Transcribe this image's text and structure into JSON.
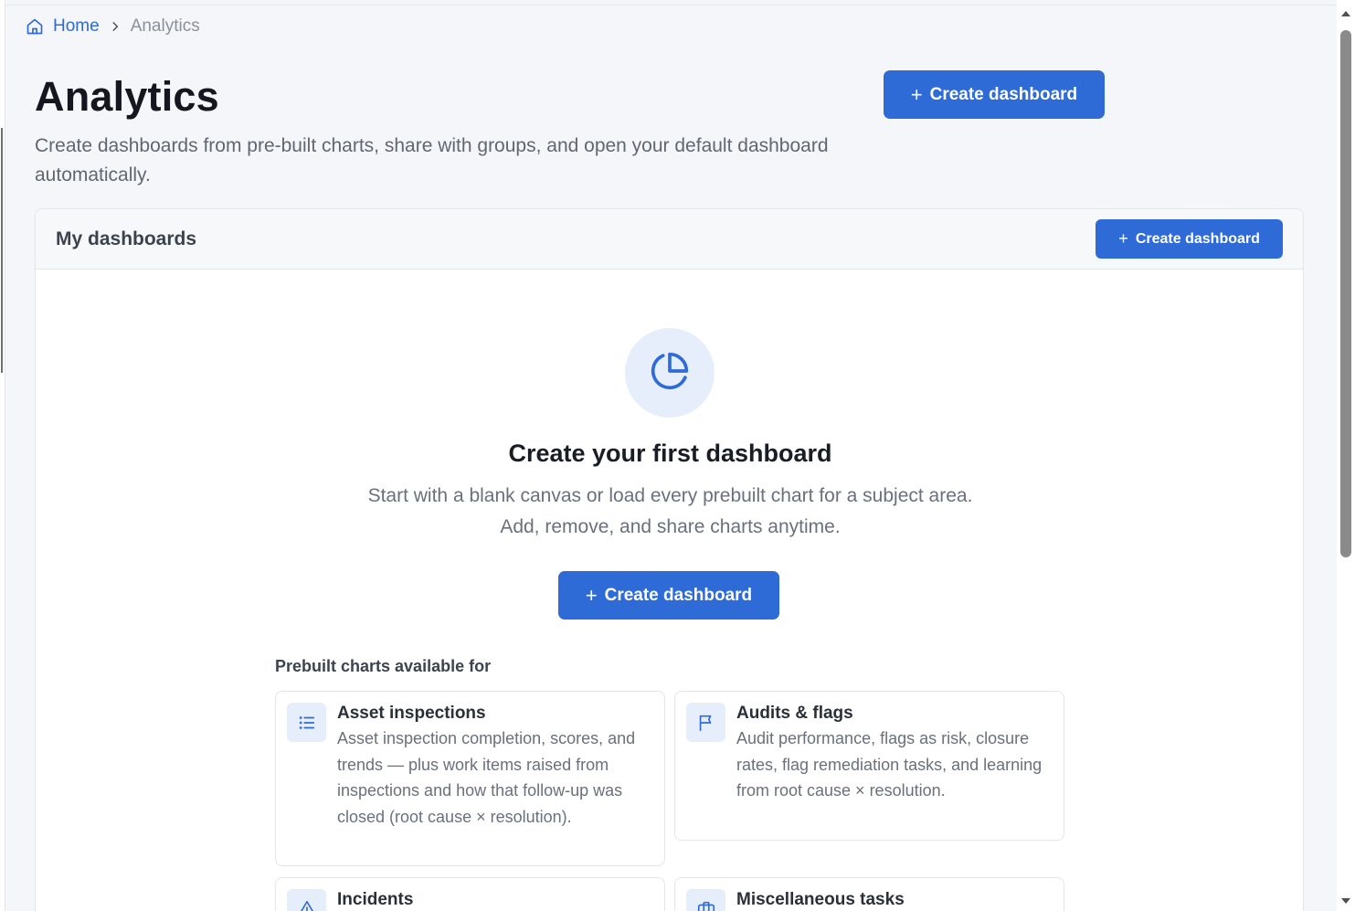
{
  "breadcrumb": {
    "home": "Home",
    "separator": "›",
    "current": "Analytics"
  },
  "header": {
    "title": "Analytics",
    "subtitle": "Create dashboards from pre-built charts, share with groups, and open your default dashboard automatically.",
    "create_label": "Create dashboard"
  },
  "my_dashboards": {
    "title": "My dashboards",
    "create_label": "Create dashboard",
    "empty_state": {
      "icon": "pie-chart-icon",
      "title": "Create your first dashboard",
      "description_line1": "Start with a blank canvas or load every prebuilt chart for a subject area.",
      "description_line2": "Add, remove, and share charts anytime.",
      "create_label": "Create dashboard"
    },
    "prebuilt_label": "Prebuilt charts available for",
    "subjects": [
      {
        "icon": "list-icon",
        "title": "Asset inspections",
        "description": "Asset inspection completion, scores, and trends — plus work items raised from inspections and how that follow-up was closed (root cause × resolution)."
      },
      {
        "icon": "flag-icon",
        "title": "Audits & flags",
        "description": "Audit performance, flags as risk, closure rates, flag remediation tasks, and learning from root cause × resolution."
      },
      {
        "icon": "warning-icon",
        "title": "Incidents",
        "description": ""
      },
      {
        "icon": "briefcase-icon",
        "title": "Miscellaneous tasks",
        "description": ""
      }
    ]
  },
  "colors": {
    "accent": "#2f6bd6",
    "page_bg": "#f4f6f9",
    "icon_tint": "#e7eefb"
  }
}
